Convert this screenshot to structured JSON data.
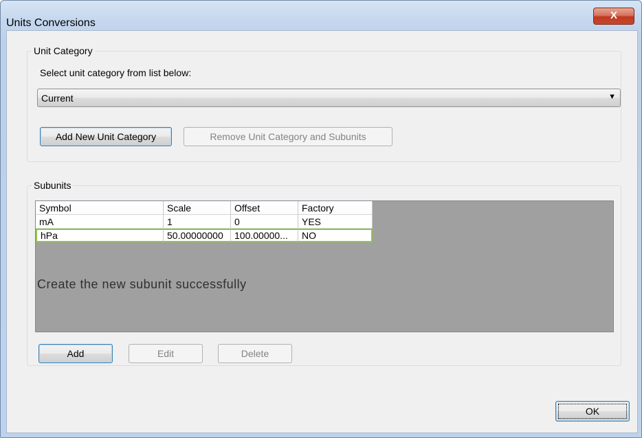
{
  "window": {
    "title": "Units Conversions",
    "close_glyph": "X"
  },
  "unit_category": {
    "legend": "Unit Category",
    "prompt": "Select unit category from list below:",
    "selected": "Current",
    "add_label": "Add New Unit Category",
    "remove_label": "Remove Unit Category and Subunits"
  },
  "subunits": {
    "legend": "Subunits",
    "columns": [
      "Symbol",
      "Scale",
      "Offset",
      "Factory"
    ],
    "rows": [
      [
        "mA",
        "1",
        "0",
        "YES"
      ],
      [
        "hPa",
        "50.00000000",
        "100.00000...",
        "NO"
      ]
    ],
    "message": "Create the new subunit successfully",
    "add_label": "Add",
    "edit_label": "Edit",
    "delete_label": "Delete"
  },
  "footer": {
    "ok_label": "OK"
  }
}
